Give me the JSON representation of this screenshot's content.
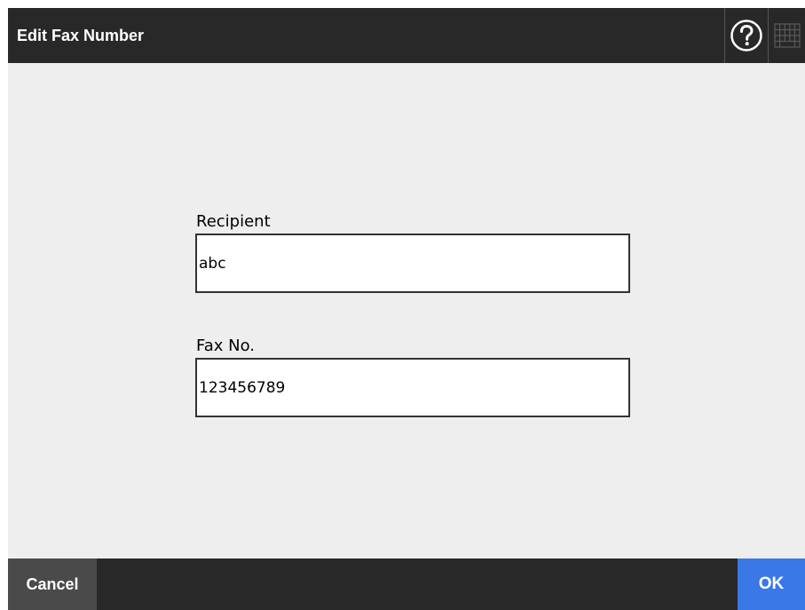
{
  "window": {
    "title": "Edit Fax Number"
  },
  "header": {
    "help_icon": "question-circle-icon",
    "keyboard_icon": "keyboard-icon"
  },
  "form": {
    "recipient_label": "Recipient",
    "recipient_value": "abc",
    "fax_label": "Fax No.",
    "fax_value": "123456789"
  },
  "footer": {
    "cancel_label": "Cancel",
    "ok_label": "OK"
  },
  "colors": {
    "bar_background": "#282828",
    "content_background": "#eeeeee",
    "cancel_background": "#4a4a4a",
    "ok_background": "#3b78e7"
  }
}
